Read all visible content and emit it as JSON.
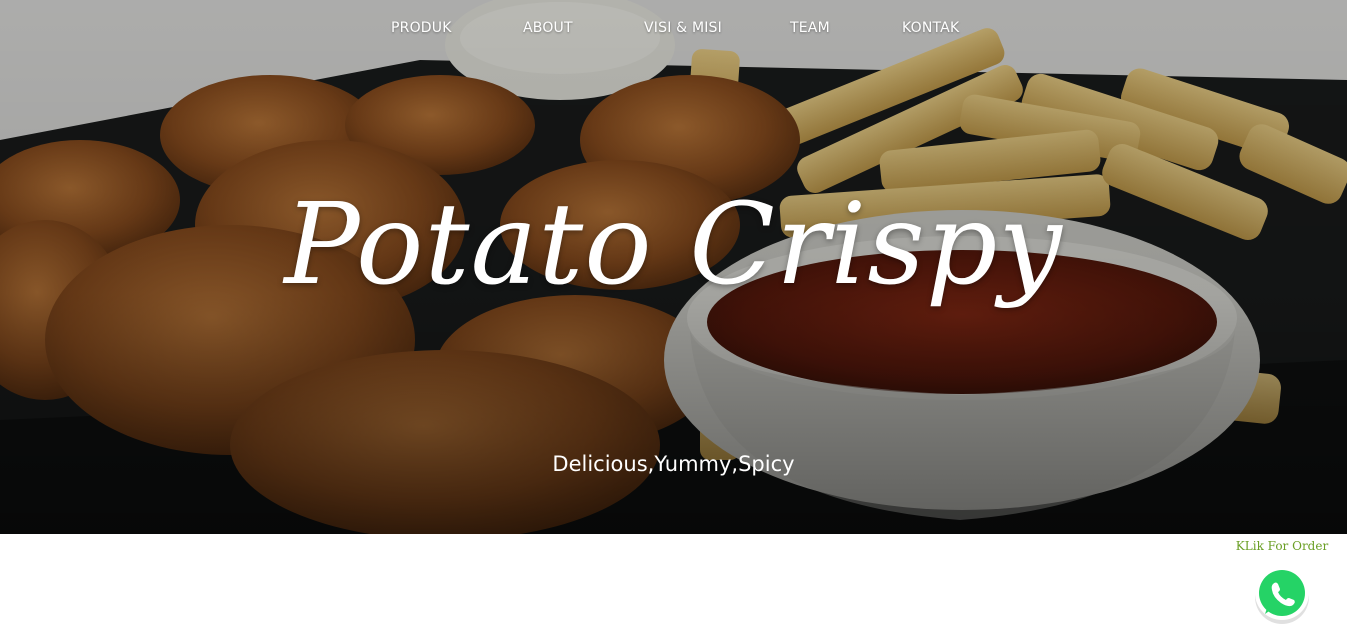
{
  "nav": {
    "items": [
      {
        "label": "PRODUK"
      },
      {
        "label": "ABOUT"
      },
      {
        "label": "VISI & MISI"
      },
      {
        "label": "TEAM"
      },
      {
        "label": "KONTAK"
      }
    ]
  },
  "hero": {
    "title": "Potato Crispy",
    "subtitle": "Delicious,Yummy,Spicy",
    "image_icon": "food-photo-nuggets-fries-sauce"
  },
  "order": {
    "label": "KLik For Order",
    "icon": "whatsapp-icon",
    "color": "#25D366",
    "label_color": "#6A9F25"
  }
}
